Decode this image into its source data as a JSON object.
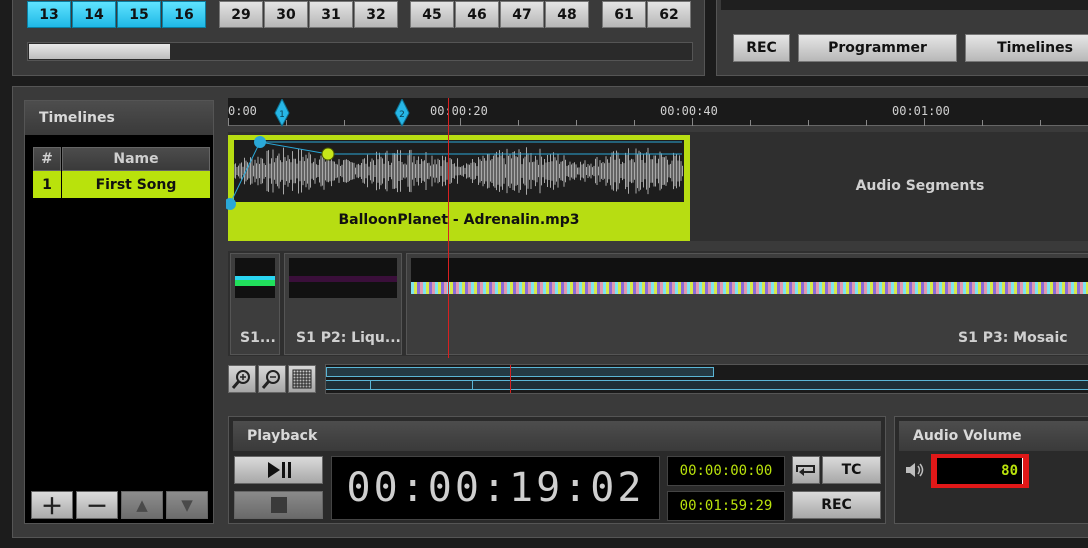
{
  "cue_buttons": {
    "groups": [
      {
        "values": [
          "13",
          "14",
          "15",
          "16"
        ],
        "active": true
      },
      {
        "values": [
          "29",
          "30",
          "31",
          "32"
        ],
        "active": false
      },
      {
        "values": [
          "45",
          "46",
          "47",
          "48"
        ],
        "active": false
      },
      {
        "values": [
          "61",
          "62"
        ],
        "active": false
      }
    ]
  },
  "top_buttons": {
    "rec": "REC",
    "programmer": "Programmer",
    "timelines": "Timelines"
  },
  "timelines_panel": {
    "title": "Timelines",
    "columns": {
      "index": "#",
      "name": "Name"
    },
    "rows": [
      {
        "index": "1",
        "name": "First Song",
        "selected": true
      }
    ],
    "buttons": {
      "add_icon": "plus-icon",
      "remove_icon": "minus-icon",
      "up_icon": "triangle-up-icon",
      "down_icon": "triangle-down-icon"
    }
  },
  "ruler": {
    "labels": [
      "0:00",
      "00:00:20",
      "00:00:40",
      "00:01:00"
    ],
    "markers": [
      "1",
      "2"
    ]
  },
  "audio_track": {
    "segment_label": "BalloonPlanet - Adrenalin.mp3",
    "empty_label": "Audio Segments"
  },
  "video_track": {
    "clips": [
      {
        "label": "S1..."
      },
      {
        "label": "S1 P2: Liqu..."
      },
      {
        "label": "S1 P3: Mosaic"
      }
    ]
  },
  "zoom_tools": {
    "zoom_in_icon": "zoom-in-icon",
    "zoom_out_icon": "zoom-out-icon",
    "fit_icon": "grid-icon"
  },
  "playback": {
    "title": "Playback",
    "current_time": "00:00:19:02",
    "start_time": "00:00:00:00",
    "end_time": "00:01:59:29",
    "tc_label": "TC",
    "rec_label": "REC",
    "play_pause_icon": "play-pause-icon",
    "stop_icon": "stop-icon",
    "loop_icon": "loop-icon"
  },
  "audio_volume": {
    "title": "Audio Volume",
    "value": "80",
    "speaker_icon": "speaker-icon"
  },
  "colors": {
    "accent_green": "#b9e20c",
    "cue_active": "#2fc6f0",
    "playhead": "#d82020",
    "highlight_red": "#e01818"
  }
}
